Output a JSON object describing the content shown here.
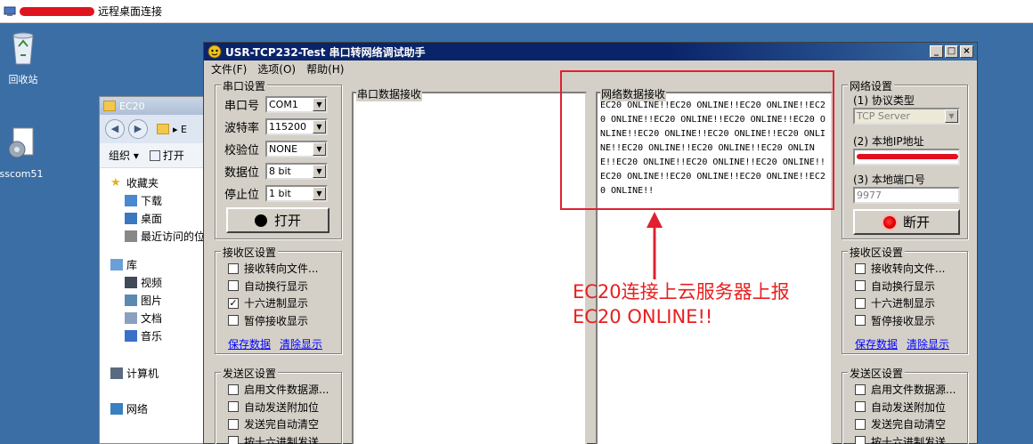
{
  "rdp": {
    "title": "远程桌面连接"
  },
  "desktop": {
    "icons": [
      {
        "label": "回收站"
      },
      {
        "label": "sscom51"
      }
    ]
  },
  "explorer": {
    "title": "EC20",
    "nav_glyph": "▸ E",
    "toolbar": {
      "organize": "组织 ▾",
      "open": "打开"
    },
    "tree": [
      {
        "label": "收藏夹",
        "icon": "star-icon"
      },
      {
        "label": "下载",
        "icon": "download-folder-icon"
      },
      {
        "label": "桌面",
        "icon": "desktop-icon"
      },
      {
        "label": "最近访问的位",
        "icon": "recent-places-icon"
      },
      {
        "label": "库",
        "icon": "library-icon"
      },
      {
        "label": "视频",
        "icon": "video-icon"
      },
      {
        "label": "图片",
        "icon": "pictures-icon"
      },
      {
        "label": "文档",
        "icon": "documents-icon"
      },
      {
        "label": "音乐",
        "icon": "music-icon"
      },
      {
        "label": "计算机",
        "icon": "computer-icon"
      },
      {
        "label": "网络",
        "icon": "network-icon"
      }
    ]
  },
  "app": {
    "title": "USR-TCP232-Test 串口转网络调试助手",
    "menu": [
      "文件(F)",
      "选项(O)",
      "帮助(H)"
    ],
    "serial": {
      "group_label": "串口设置",
      "port_label": "串口号",
      "port_value": "COM1",
      "baud_label": "波特率",
      "baud_value": "115200",
      "parity_label": "校验位",
      "parity_value": "NONE",
      "data_label": "数据位",
      "data_value": "8 bit",
      "stop_label": "停止位",
      "stop_value": "1 bit",
      "open_button": "打开"
    },
    "recv_left": {
      "group_label": "接收区设置",
      "options": [
        {
          "label": "接收转向文件...",
          "checked": false
        },
        {
          "label": "自动换行显示",
          "checked": false
        },
        {
          "label": "十六进制显示",
          "checked": true
        },
        {
          "label": "暂停接收显示",
          "checked": false
        }
      ],
      "save": "保存数据",
      "clear": "清除显示"
    },
    "send_left": {
      "group_label": "发送区设置",
      "options": [
        {
          "label": "启用文件数据源...",
          "checked": false
        },
        {
          "label": "自动发送附加位",
          "checked": false
        },
        {
          "label": "发送完自动清空",
          "checked": false
        },
        {
          "label": "按十六进制发送",
          "checked": false
        }
      ]
    },
    "serial_recv": {
      "label": "串口数据接收"
    },
    "net_recv": {
      "label": "网络数据接收",
      "content": "EC20 ONLINE!!EC20 ONLINE!!EC20 ONLINE!!EC20 ONLINE!!EC20 ONLINE!!EC20 ONLINE!!EC20 ONLINE!!EC20 ONLINE!!EC20 ONLINE!!EC20 ONLINE!!EC20 ONLINE!!EC20 ONLINE!!EC20 ONLINE!!EC20 ONLINE!!EC20 ONLINE!!EC20 ONLINE!!EC20 ONLINE!!EC20 ONLINE!!EC20 ONLINE!!EC20 ONLINE!!"
    },
    "network": {
      "group_label": "网络设置",
      "protocol_label": "(1) 协议类型",
      "protocol_value": "TCP Server",
      "ip_label": "(2) 本地IP地址",
      "port_label": "(3) 本地端口号",
      "port_value": "9977",
      "disconnect_button": "断开"
    },
    "recv_right": {
      "group_label": "接收区设置",
      "options": [
        {
          "label": "接收转向文件...",
          "checked": false
        },
        {
          "label": "自动换行显示",
          "checked": false
        },
        {
          "label": "十六进制显示",
          "checked": false
        },
        {
          "label": "暂停接收显示",
          "checked": false
        }
      ],
      "save": "保存数据",
      "clear": "清除显示"
    },
    "send_right": {
      "group_label": "发送区设置",
      "options": [
        {
          "label": "启用文件数据源...",
          "checked": false
        },
        {
          "label": "自动发送附加位",
          "checked": false
        },
        {
          "label": "发送完自动清空",
          "checked": false
        },
        {
          "label": "按十六进制发送",
          "checked": false
        }
      ]
    }
  },
  "annotation": {
    "line1": "EC20连接上云服务器上报",
    "line2": "EC20 ONLINE!!",
    "color": "#e82020"
  }
}
